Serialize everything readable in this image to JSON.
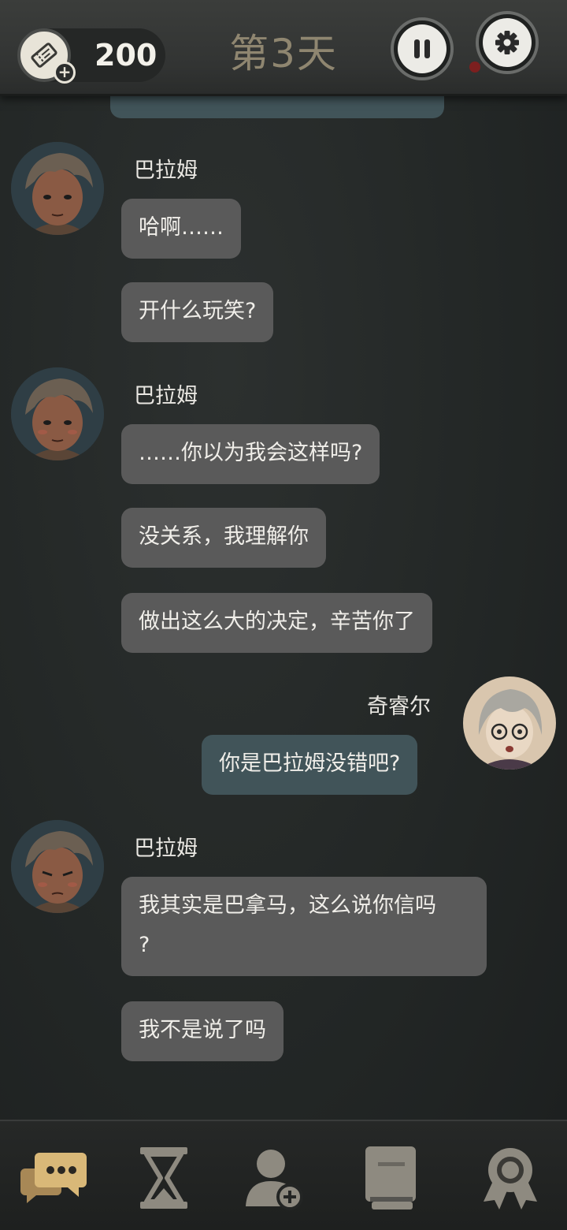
{
  "header": {
    "ticket_count": "200",
    "day_title": "第3天",
    "icons": {
      "ticket": "ticket-icon",
      "plus": "plus-icon",
      "pause": "pause-icon",
      "settings": "gear-icon"
    }
  },
  "chat": {
    "messages": [
      {
        "side": "right",
        "text": ""
      },
      {
        "side": "left",
        "sender": "巴拉姆",
        "texts": [
          "哈啊……",
          "开什么玩笑?"
        ]
      },
      {
        "side": "left",
        "sender": "巴拉姆",
        "texts": [
          "……你以为我会这样吗?",
          "没关系，我理解你",
          "做出这么大的决定，辛苦你了"
        ]
      },
      {
        "side": "right",
        "sender": "奇睿尔",
        "texts": [
          "你是巴拉姆没错吧?"
        ]
      },
      {
        "side": "left",
        "sender": "巴拉姆",
        "texts": [
          "我其实是巴拿马，这么说你信吗\n?",
          "我不是说了吗"
        ]
      }
    ]
  },
  "bottom_nav": {
    "items": [
      {
        "icon": "chat-bubbles-icon",
        "active": true
      },
      {
        "icon": "hourglass-icon",
        "active": false
      },
      {
        "icon": "add-contact-icon",
        "active": false
      },
      {
        "icon": "book-icon",
        "active": false
      },
      {
        "icon": "achievement-medal-icon",
        "active": false
      }
    ]
  },
  "colors": {
    "background": "#232726",
    "left_bubble": "#5a5a5a",
    "right_bubble": "#415459",
    "accent_gold": "#c9a86a",
    "inactive_icon": "#8e8a80"
  }
}
